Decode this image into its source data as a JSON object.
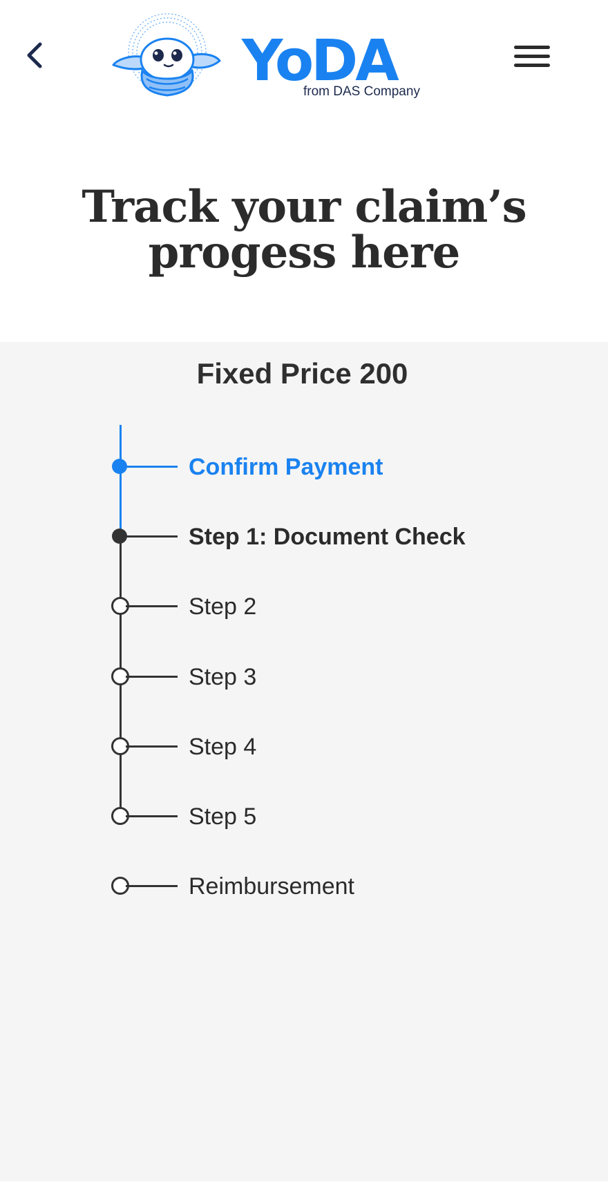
{
  "header": {
    "brand_word": "YoDA",
    "brand_tagline": "from DAS Company",
    "back_icon": "chevron-left-icon",
    "menu_icon": "hamburger-menu-icon"
  },
  "page": {
    "title": "Track your claim’s progess here"
  },
  "claim": {
    "plan_name": "Fixed Price 200",
    "steps": [
      {
        "label": "Confirm Payment",
        "status": "done"
      },
      {
        "label": "Step 1: Document Check",
        "status": "current"
      },
      {
        "label": "Step 2",
        "status": "todo"
      },
      {
        "label": "Step 3",
        "status": "todo"
      },
      {
        "label": "Step 4",
        "status": "todo"
      },
      {
        "label": "Step 5",
        "status": "todo"
      },
      {
        "label": "Reimbursement",
        "status": "todo"
      }
    ]
  },
  "colors": {
    "accent": "#1a82f0",
    "text": "#2b2b2b",
    "panel_bg": "#f5f5f5",
    "navy": "#1d2a4d"
  }
}
